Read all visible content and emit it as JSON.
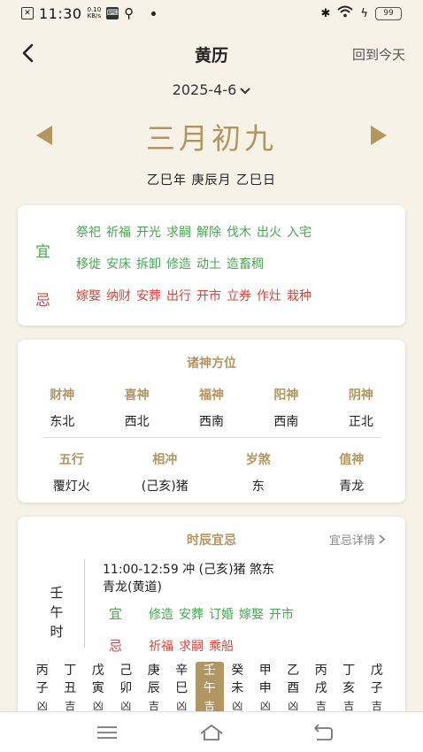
{
  "status": {
    "time": "11:30",
    "speed_value": "0.10",
    "speed_unit": "KB/s",
    "battery": "99"
  },
  "header": {
    "title": "黄历",
    "today_label": "回到今天"
  },
  "date_picker": {
    "value": "2025-4-6"
  },
  "lunar": {
    "date": "三月初九",
    "ganzhi": "乙巳年 庚辰月 乙巳日"
  },
  "yiji": {
    "yi_label": "宜",
    "ji_label": "忌",
    "yi_row1": [
      "祭祀",
      "祈福",
      "开光",
      "求嗣",
      "解除",
      "伐木",
      "出火",
      "入宅"
    ],
    "yi_row2": [
      "移徙",
      "安床",
      "拆卸",
      "修造",
      "动土",
      "造畜稠"
    ],
    "ji": [
      "嫁娶",
      "纳财",
      "安葬",
      "出行",
      "开市",
      "立券",
      "作灶",
      "栽种"
    ]
  },
  "gods": {
    "title": "诸神方位",
    "row1": [
      {
        "label": "财神",
        "value": "东北"
      },
      {
        "label": "喜神",
        "value": "西北"
      },
      {
        "label": "福神",
        "value": "西南"
      },
      {
        "label": "阳神",
        "value": "西南"
      },
      {
        "label": "阴神",
        "value": "正北"
      }
    ],
    "row2": [
      {
        "label": "五行",
        "value": "覆灯火"
      },
      {
        "label": "相冲",
        "value": "(己亥)猪"
      },
      {
        "label": "岁煞",
        "value": "东"
      },
      {
        "label": "值神",
        "value": "青龙"
      }
    ]
  },
  "hours": {
    "title": "时辰宜忌",
    "detail_label": "宜忌详情",
    "current_name": "壬午时",
    "desc_line1": "11:00-12:59 冲 (己亥)猪 煞东",
    "desc_line2": "青龙(黄道)",
    "yi_label": "宜",
    "ji_label": "忌",
    "yi": [
      "修造",
      "安葬",
      "订婚",
      "嫁娶",
      "开市"
    ],
    "ji": [
      "祈福",
      "求嗣",
      "乘船"
    ],
    "strip": [
      {
        "gan": "丙",
        "zhi": "子",
        "luck": "凶"
      },
      {
        "gan": "丁",
        "zhi": "丑",
        "luck": "吉"
      },
      {
        "gan": "戊",
        "zhi": "寅",
        "luck": "凶"
      },
      {
        "gan": "己",
        "zhi": "卯",
        "luck": "凶"
      },
      {
        "gan": "庚",
        "zhi": "辰",
        "luck": "吉"
      },
      {
        "gan": "辛",
        "zhi": "巳",
        "luck": "凶"
      },
      {
        "gan": "壬",
        "zhi": "午",
        "luck": "吉",
        "active": true
      },
      {
        "gan": "癸",
        "zhi": "未",
        "luck": "凶"
      },
      {
        "gan": "甲",
        "zhi": "申",
        "luck": "凶"
      },
      {
        "gan": "乙",
        "zhi": "酉",
        "luck": "凶"
      },
      {
        "gan": "丙",
        "zhi": "戌",
        "luck": "吉"
      },
      {
        "gan": "丁",
        "zhi": "亥",
        "luck": "吉"
      },
      {
        "gan": "戊",
        "zhi": "子",
        "luck": "吉"
      }
    ]
  },
  "colors": {
    "gold": "#b39560",
    "good": "#4aa552",
    "bad": "#d9453b",
    "background": "#f6f2e7"
  }
}
